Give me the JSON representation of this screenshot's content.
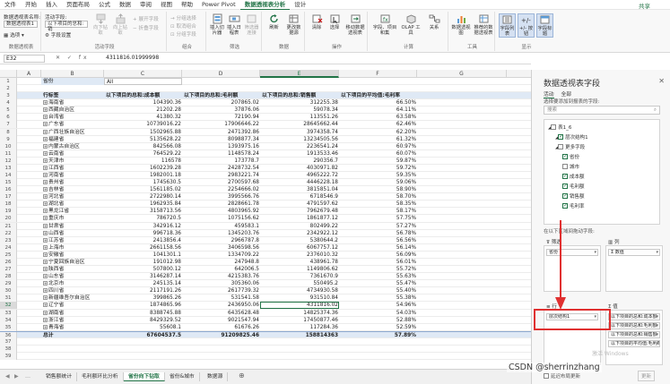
{
  "menu": {
    "tabs": [
      "文件",
      "开始",
      "插入",
      "页面布局",
      "公式",
      "数据",
      "审阅",
      "视图",
      "帮助",
      "Power Pivot",
      "数据透视表分析",
      "设计"
    ],
    "active_index": 10,
    "share": "共享"
  },
  "ribbon": {
    "pivot_name_label": "数据透视表名称:",
    "pivot_name_value": "数据透视表1",
    "options_label": "选项",
    "group_pivot": "数据透视表",
    "active_field_label": "活动字段:",
    "active_field_value": "以下项目的总和:销",
    "field_settings": "字段设置",
    "drill_down": "向下钻取",
    "drill_up": "向上钻取",
    "group_active_field": "活动字段",
    "expand_field": "展开字段",
    "collapse_field": "折叠字段",
    "group_selection": "分组选择",
    "ungroup": "取消组合",
    "group_field": "分组字段",
    "group_group": "组合",
    "insert_slicer": "插入切片器",
    "insert_timeline": "插入日程表",
    "filter_connections": "筛选器连接",
    "group_filter": "筛选",
    "refresh": "刷新",
    "change_source": "更改数据源",
    "group_data": "数据",
    "clear": "清除",
    "select": "选择",
    "move_pivot": "移动数据透视表",
    "group_actions": "操作",
    "fields_items_sets": "字段、项目和集",
    "olap_tools": "OLAP 工具",
    "relationships": "关系",
    "group_calc": "计算",
    "pivot_chart": "数据透视图",
    "recommended": "推荐的数据透视表",
    "group_tools": "工具",
    "field_list": "字段列表",
    "plus_minus": "+/- 按钮",
    "field_headers": "字段标题",
    "group_show": "显示"
  },
  "formula_bar": {
    "name_box": "E32",
    "fx": "✕ ✓ fx",
    "value": "4311816.01999998"
  },
  "columns": [
    "A",
    "B",
    "C",
    "D",
    "E",
    "F",
    "G"
  ],
  "pivot": {
    "filter_label": "省份",
    "filter_value": "All",
    "headers": [
      "行标签",
      "以下项目的总和:成本额",
      "以下项目的总和:毛利额",
      "以下项目的总和:销售额",
      "以下项目的平均值:毛利率"
    ],
    "rows": [
      [
        "海南省",
        "104390.36",
        "207865.02",
        "312255.38",
        "66.50%"
      ],
      [
        "西藏自治区",
        "21202.28",
        "37876.06",
        "59078.34",
        "64.11%"
      ],
      [
        "台湾省",
        "41380.32",
        "72190.94",
        "113551.26",
        "63.58%"
      ],
      [
        "广东省",
        "10739016.22",
        "17906646.22",
        "28645662.44",
        "62.46%"
      ],
      [
        "广西壮族自治区",
        "1502965.88",
        "2471392.86",
        "3974358.74",
        "62.20%"
      ],
      [
        "福建省",
        "5135628.22",
        "8098877.34",
        "13234505.56",
        "61.32%"
      ],
      [
        "内蒙古自治区",
        "842566.08",
        "1393975.16",
        "2236541.24",
        "60.97%"
      ],
      [
        "云南省",
        "764529.22",
        "1148578.24",
        "1913533.46",
        "60.07%"
      ],
      [
        "天津市",
        "116578",
        "173778.7",
        "290356.7",
        "59.87%"
      ],
      [
        "江西省",
        "1602239.28",
        "2428732.54",
        "4030971.82",
        "59.72%"
      ],
      [
        "河南省",
        "1982001.18",
        "2983221.74",
        "4965222.72",
        "59.35%"
      ],
      [
        "贵州省",
        "1745630.5",
        "2700597.68",
        "4446228.18",
        "59.06%"
      ],
      [
        "吉林省",
        "1561185.02",
        "2254666.02",
        "3815851.04",
        "58.90%"
      ],
      [
        "河北省",
        "2722980.14",
        "3995566.76",
        "6718546.9",
        "58.70%"
      ],
      [
        "湖北省",
        "1962935.84",
        "2828661.78",
        "4791597.62",
        "58.35%"
      ],
      [
        "黑龙江省",
        "3158713.56",
        "4803965.92",
        "7962679.48",
        "58.17%"
      ],
      [
        "重庆市",
        "786720.5",
        "1075156.62",
        "1861877.12",
        "57.75%"
      ],
      [
        "甘肃省",
        "342916.12",
        "459583.1",
        "802499.22",
        "57.27%"
      ],
      [
        "山西省",
        "996718.36",
        "1345203.76",
        "2342922.12",
        "56.78%"
      ],
      [
        "江苏省",
        "2413856.4",
        "2966787.8",
        "5380644.2",
        "56.56%"
      ],
      [
        "上海市",
        "2661158.56",
        "3406598.56",
        "6067757.12",
        "56.14%"
      ],
      [
        "安徽省",
        "1041301.1",
        "1334709.22",
        "2376010.32",
        "56.09%"
      ],
      [
        "宁夏回族自治区",
        "191012.98",
        "247948.8",
        "438961.78",
        "56.01%"
      ],
      [
        "陕西省",
        "507800.12",
        "642006.5",
        "1149806.62",
        "55.72%"
      ],
      [
        "山东省",
        "3146287.14",
        "4215383.76",
        "7361670.9",
        "55.63%"
      ],
      [
        "北京市",
        "245135.14",
        "305360.06",
        "550495.2",
        "55.47%"
      ],
      [
        "四川省",
        "2117191.26",
        "2617739.32",
        "4734930.58",
        "55.40%"
      ],
      [
        "新疆维吾尔自治区",
        "399865.26",
        "531541.58",
        "931510.84",
        "55.38%"
      ],
      [
        "辽宁省",
        "1874865.96",
        "2436950.06",
        "4311816.02",
        "54.96%"
      ],
      [
        "湖南省",
        "8388745.88",
        "6435628.48",
        "14825374.36",
        "54.03%"
      ],
      [
        "浙江省",
        "8429329.52",
        "9021547.94",
        "17450877.46",
        "52.88%"
      ],
      [
        "青海省",
        "55608.1",
        "61676.26",
        "117284.36",
        "52.59%"
      ]
    ],
    "total": [
      "总计",
      "67604537.5",
      "91209825.46",
      "158814363",
      "57.89%"
    ]
  },
  "sheets": {
    "tabs": [
      "销售额统计",
      "毛利额环比分析",
      "省份向下钻取",
      "省份&城市",
      "数据源"
    ],
    "active_index": 2
  },
  "panel": {
    "title": "数据透视表字段",
    "tab_active": "活动",
    "tab_all": "全部",
    "hint": "选择要添加到报表的字段:",
    "search_placeholder": "搜索",
    "fields": [
      {
        "label": "表1_6",
        "checked": false,
        "level": 0
      },
      {
        "label": "层次结构1",
        "checked": true,
        "level": 1
      },
      {
        "label": "更多字段",
        "checked": false,
        "level": 1
      },
      {
        "label": "省份",
        "checked": true,
        "level": 2
      },
      {
        "label": "城市",
        "checked": false,
        "level": 2
      },
      {
        "label": "成本额",
        "checked": true,
        "level": 2
      },
      {
        "label": "毛利额",
        "checked": true,
        "level": 2
      },
      {
        "label": "销售额",
        "checked": true,
        "level": 2
      },
      {
        "label": "毛利率",
        "checked": true,
        "level": 2
      }
    ],
    "drag_tip": "在以下区域间拖动字段:",
    "filters_label": "筛选",
    "filters_items": [
      "省份"
    ],
    "columns_label": "列",
    "columns_items": [
      "Σ 数值"
    ],
    "rows_label": "行",
    "rows_items": [
      "层次结构1"
    ],
    "values_label": "Σ 值",
    "values_items": [
      "以下项目的总和:成本额",
      "以下项目的总和:毛利额",
      "以下项目的总和:销售额",
      "以下项目的平均值:毛利率"
    ],
    "defer_label": "延迟布局更新",
    "update_label": "更新"
  },
  "watermark": "CSDN @sherrinzhang",
  "win_mark": "激活 Windows",
  "colors": {
    "excel_green": "#217346",
    "annotation_red": "#e03030",
    "pivot_header": "#dfe9f5"
  }
}
